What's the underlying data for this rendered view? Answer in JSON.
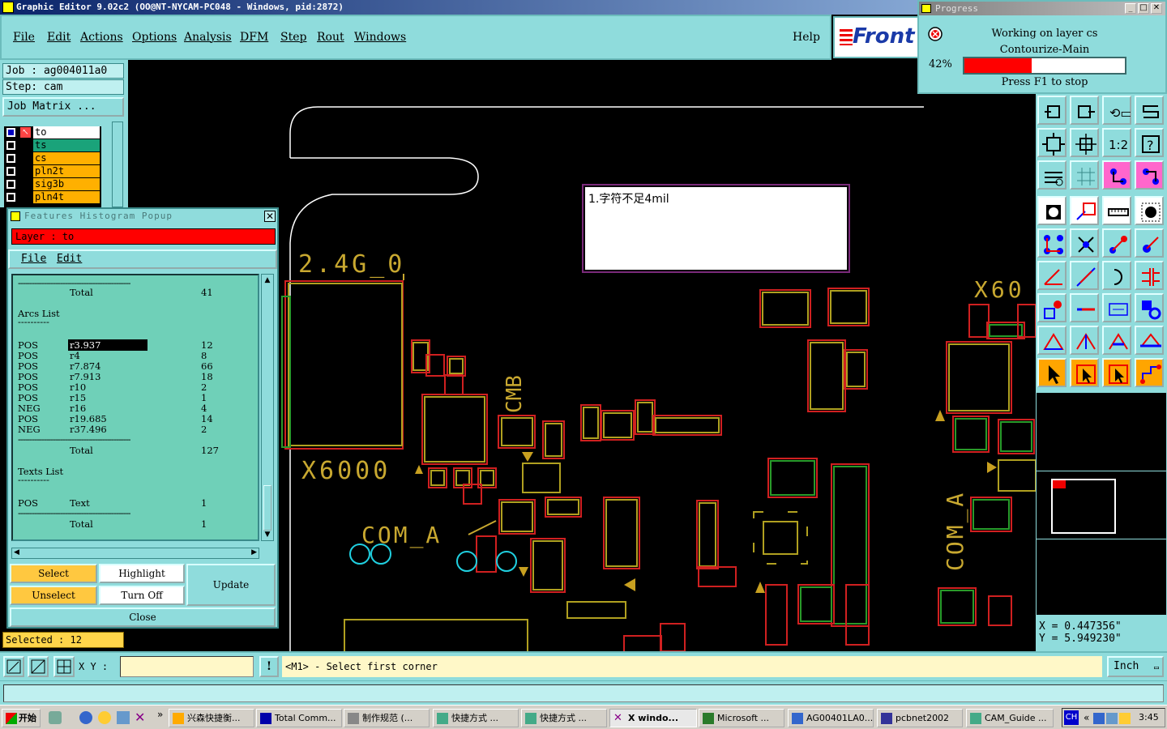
{
  "window": {
    "title": "Graphic Editor 9.02c2 (OO@NT-NYCAM-PC048 - Windows, pid:2872)"
  },
  "menu": {
    "items": [
      "File",
      "Edit",
      "Actions",
      "Options",
      "Analysis",
      "DFM",
      "Step",
      "Rout",
      "Windows"
    ],
    "help": "Help",
    "logo": "Front"
  },
  "left": {
    "job": "Job : ag004011a0",
    "step": "Step: cam",
    "job_matrix": "Job Matrix ..."
  },
  "layers": [
    {
      "name": "to",
      "color": "#ffffff"
    },
    {
      "name": "ts",
      "color": "#1aa37a"
    },
    {
      "name": "cs",
      "color": "#ffb000"
    },
    {
      "name": "pln2t",
      "color": "#ffb000"
    },
    {
      "name": "sig3b",
      "color": "#ffb000"
    },
    {
      "name": "pln4t",
      "color": "#ffb000"
    }
  ],
  "histogram": {
    "title": "Features Histogram Popup",
    "layer_label": "Layer :  to",
    "menu_file": "File",
    "menu_edit": "Edit",
    "total_label": "Total",
    "top_total": "41",
    "arcs_header": "Arcs List",
    "arcs": [
      {
        "pol": "POS",
        "sym": "r3.937",
        "count": "12",
        "selected": true
      },
      {
        "pol": "POS",
        "sym": "r4",
        "count": "8"
      },
      {
        "pol": "POS",
        "sym": "r7.874",
        "count": "66"
      },
      {
        "pol": "POS",
        "sym": "r7.913",
        "count": "18"
      },
      {
        "pol": "POS",
        "sym": "r10",
        "count": "2"
      },
      {
        "pol": "POS",
        "sym": "r15",
        "count": "1"
      },
      {
        "pol": "NEG",
        "sym": "r16",
        "count": "4"
      },
      {
        "pol": "POS",
        "sym": "r19.685",
        "count": "14"
      },
      {
        "pol": "NEG",
        "sym": "r37.496",
        "count": "2"
      }
    ],
    "arcs_total": "127",
    "texts_header": "Texts List",
    "texts": [
      {
        "pol": "POS",
        "sym": "Text",
        "count": "1"
      }
    ],
    "texts_total": "1",
    "buttons": {
      "select": "Select",
      "highlight": "Highlight",
      "update": "Update",
      "unselect": "Unselect",
      "turn_off": "Turn Off",
      "close": "Close"
    }
  },
  "selected": "Selected : 12",
  "progress": {
    "title": "Progress",
    "line1": "Working on layer cs",
    "line2": "Contourize-Main",
    "percent_label": "42%",
    "percent": 0.42,
    "stop": "Press F1 to stop"
  },
  "note": "1.字符不足4mil",
  "pcb_labels": {
    "label1": "2.4G_0",
    "label2": "X6000",
    "label3": "CMB",
    "label4": "COM_A",
    "label5": "X60",
    "label6": "COM_A"
  },
  "coords": {
    "x": "X = 0.447356\"",
    "y": "Y = 5.949230\""
  },
  "cmd": {
    "xy_label": "X Y :",
    "xy_value": "",
    "message": "<M1> - Select first corner",
    "units": "Inch"
  },
  "taskbar": {
    "start": "开始",
    "tasks": [
      "兴森快捷衡...",
      "Total Comm...",
      "制作规范 (...",
      "快捷方式 ...",
      "快捷方式 ...",
      "X windo...",
      "Microsoft ...",
      "AG00401LA0...",
      "pcbnet2002",
      "CAM_Guide ..."
    ],
    "lang": "CH",
    "time": "3:45"
  },
  "colors": {
    "panel": "#8fdcdc",
    "pad_red": "#e02020",
    "pad_yellow": "#c8a820",
    "silk": "#c8a830",
    "progress_fill": "#ff0000"
  }
}
